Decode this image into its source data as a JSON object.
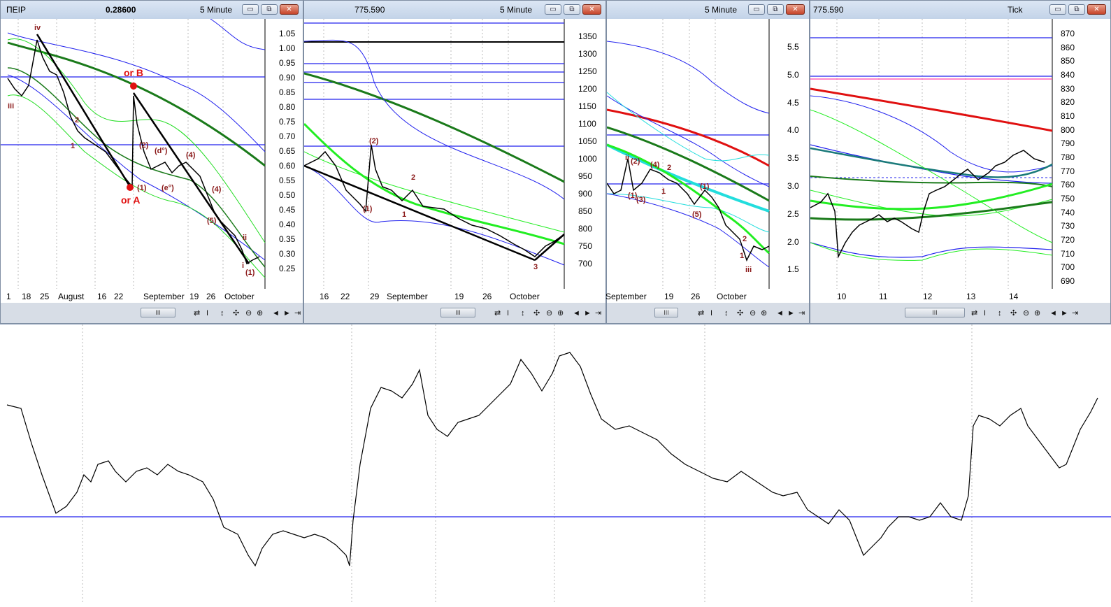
{
  "panels": [
    {
      "title_symbol": "ПЕІР",
      "title_price": "0.28600",
      "title_interval": "5 Minute",
      "y_labels": [
        "1.05",
        "1.00",
        "0.95",
        "0.90",
        "0.85",
        "0.80",
        "0.75",
        "0.70",
        "0.65",
        "0.60",
        "0.55",
        "0.50",
        "0.45",
        "0.40",
        "0.35",
        "0.30",
        "0.25"
      ],
      "date_labels": [
        "1",
        "18",
        "25",
        "August",
        "16",
        "22",
        "September",
        "19",
        "26",
        "October"
      ],
      "annotations": [
        "iv",
        "iii",
        "or B",
        "or A",
        "(2)",
        "(d°)",
        "(4)",
        "(1)",
        "(e°)",
        "(4)",
        "(5)",
        "ii",
        "(1)",
        "2",
        "1",
        "i"
      ]
    },
    {
      "title_price": "775.590",
      "title_interval": "5 Minute",
      "y_labels": [
        "1350",
        "1300",
        "1250",
        "1200",
        "1150",
        "1100",
        "1050",
        "1000",
        "950",
        "900",
        "850",
        "800",
        "750",
        "700"
      ],
      "date_labels": [
        "16",
        "22",
        "29",
        "September",
        "19",
        "26",
        "October"
      ],
      "annotations": [
        "(2)",
        "(1)",
        "2",
        "1",
        "3"
      ]
    },
    {
      "title_interval": "5 Minute",
      "y_labels": [
        "5.5",
        "5.0",
        "4.5",
        "4.0",
        "3.5",
        "3.0",
        "2.5",
        "2.0",
        "1.5"
      ],
      "date_labels": [
        "September",
        "19",
        "26",
        "October"
      ],
      "annotations": [
        "ii",
        "(2)",
        "(4)",
        "2",
        "(1)",
        "(3)",
        "1",
        "(5)",
        "(1)",
        "iii",
        "1",
        "2"
      ]
    },
    {
      "title_price": "775.590",
      "title_interval": "Tick",
      "y_labels": [
        "870",
        "860",
        "850",
        "840",
        "830",
        "820",
        "810",
        "800",
        "790",
        "780",
        "770",
        "760",
        "750",
        "740",
        "730",
        "720",
        "710",
        "700",
        "690"
      ],
      "date_labels": [
        "10",
        "11",
        "12",
        "13",
        "14"
      ],
      "annotations": []
    }
  ],
  "window_buttons": {
    "minimize": "▭",
    "restore": "⧉",
    "close": "✕"
  },
  "toolbar": {
    "scroll_thumb": "III",
    "icons": [
      "refresh-icon",
      "cursor-icon",
      "crosshair-icon",
      "move-icon",
      "zoom-out-icon",
      "zoom-in-icon",
      "scroll-left-icon",
      "scroll-right-icon",
      "end-icon"
    ],
    "glyphs": [
      "⇄",
      "I",
      "↕",
      "✣",
      "⊖",
      "⊕",
      "◄",
      "►",
      "⇥"
    ]
  },
  "colors": {
    "title_bg": "#c9d7ea",
    "accent_red": "#e01010",
    "line_blue": "#1a1aff",
    "ma_green": "#1a7a1a",
    "bright_green": "#22ee22",
    "cyan": "#22dddd"
  }
}
